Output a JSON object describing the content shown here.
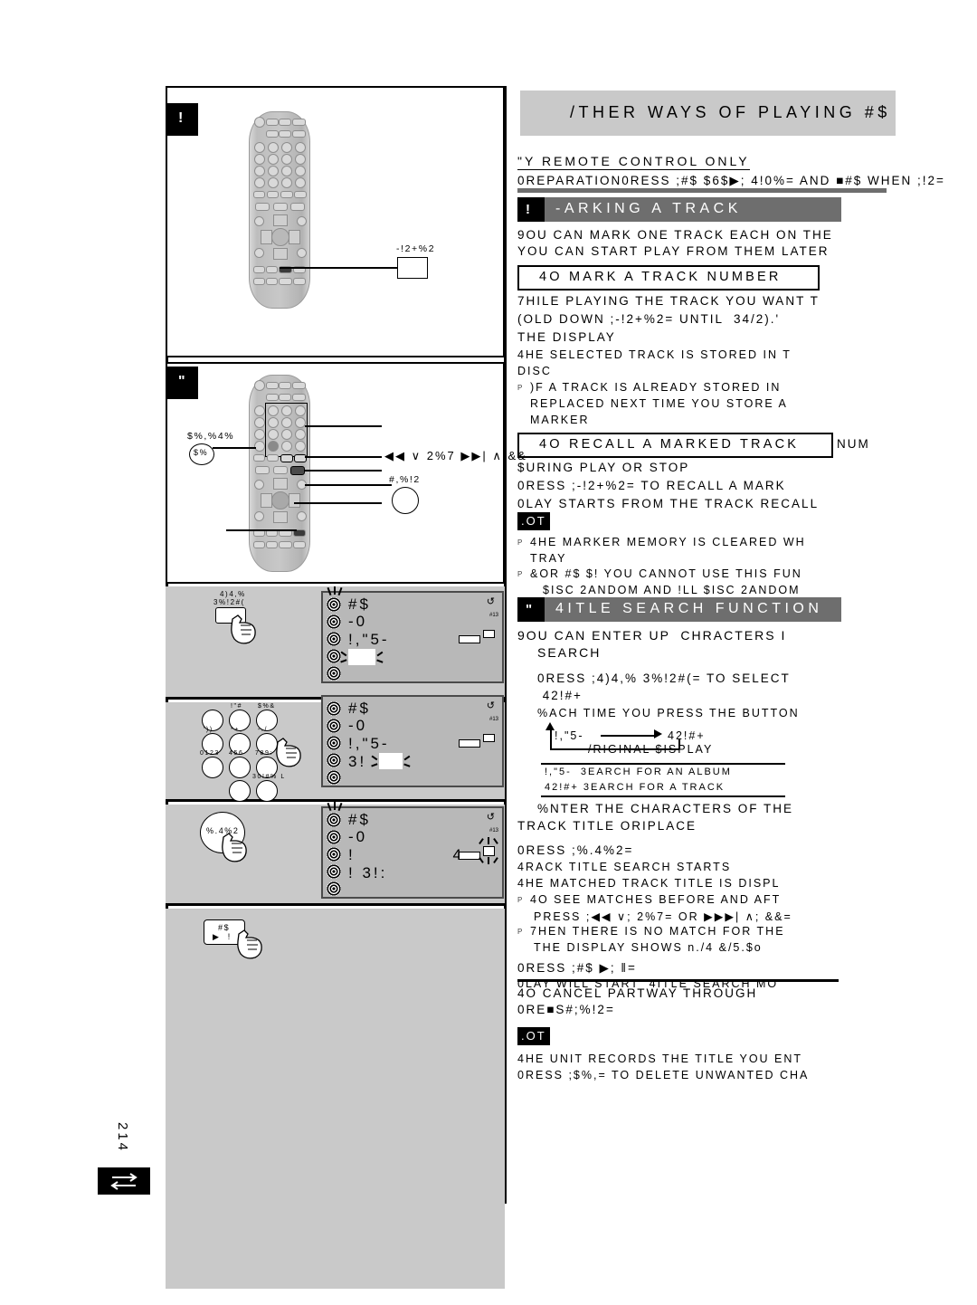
{
  "page": {
    "number": "214",
    "header_title": "/THER WAYS OF PLAYING #$",
    "subhead": "\"Y REMOTE CONTROL ONLY",
    "subline": "0REPARATION0RESS ;#$ $6$▶; 4!0%= AND  ■#$  WHEN ;!2=",
    "accent_gray": "#c9c9c9",
    "accent_darkgray": "#6e6e6e",
    "ink": "#000000"
  },
  "sections": [
    {
      "letter": "!",
      "title": "-ARKING A TRACK",
      "intro": [
        "9OU CAN MARK ONE TRACK EACH ON THE",
        "YOU CAN START PLAY FROM THEM LATER"
      ],
      "sub_boxes": [
        {
          "box_title": "4O MARK A TRACK NUMBER",
          "box_suffix": "",
          "lines": [
            "7HILE PLAYING THE TRACK YOU WANT T",
            "(OLD DOWN ;-!2+%2= UNTIL  34/2).'",
            "THE DISPLAY",
            "4HE SELECTED TRACK IS STORED IN T",
            "DISC"
          ],
          "bullets": [
            [
              ")F A TRACK IS ALREADY STORED IN",
              "REPLACED NEXT TIME YOU STORE A",
              "MARKER"
            ]
          ]
        },
        {
          "box_title": "4O RECALL A MARKED TRACK",
          "box_suffix": "NUM",
          "lines": [
            "$URING PLAY OR STOP",
            "0RESS ;-!2+%2= TO RECALL A MARK",
            "0LAY STARTS FROM THE TRACK RECALL"
          ],
          "bullets": []
        }
      ],
      "note": {
        "badge": ".OT",
        "bullets": [
          [
            "4HE MARKER MEMORY IS CLEARED WH",
            "TRAY"
          ],
          [
            "&OR #$ $! YOU CANNOT USE THIS FUN",
            "$ISC 2ANDOM AND !LL $ISC 2ANDOM"
          ]
        ]
      }
    },
    {
      "letter": "\"",
      "title": "4ITLE SEARCH FUNCTION",
      "intro": [
        "9OU CAN ENTER UP  CHRACTERS I",
        "SEARCH"
      ],
      "steps": [
        {
          "num": "",
          "lines": [
            "0RESS ;4)4,% 3%!2#(= TO SELECT",
            " 42!#+"
          ],
          "sub": [
            "%ACH TIME YOU PRESS THE BUTTON"
          ],
          "cycle": {
            "left": "!,\"5-",
            "right": "42!#+",
            "back": "/RIGINAL $ISPLAY"
          },
          "table": [
            "!,\"5-  3EARCH FOR AN ALBUM",
            "42!#+ 3EARCH FOR A TRACK"
          ]
        },
        {
          "num": "",
          "lines": [
            "%NTER THE CHARACTERS OF THE",
            "TRACK TITLE ORIPLACE"
          ],
          "sub": [],
          "cycle": null,
          "table": []
        },
        {
          "num": "",
          "lines": [
            "0RESS ;%.4%2="
          ],
          "sub": [
            "4RACK TITLE SEARCH STARTS",
            "4HE MATCHED TRACK TITLE IS DISPL"
          ],
          "bullets": [
            [
              "4O SEE MATCHES BEFORE AND AFT",
              "PRESS ;◀◀ ∨; 2%7= OR ▶▶▶| ∧; &&="
            ],
            [
              "7HEN THERE IS NO MATCH FOR THE",
              "THE DISPLAY SHOWS n./4 &/5.$o"
            ]
          ],
          "cycle": null,
          "table": []
        },
        {
          "num": "",
          "lines": [
            "0RESS ;#$ ▶; ‖="
          ],
          "sub": [
            "0LAY WILL START  4ITLE SEARCH MO"
          ],
          "cycle": null,
          "table": []
        }
      ],
      "cancel": {
        "title": "4O CANCEL PARTWAY THROUGH",
        "line": "0RE■S#;%!2="
      },
      "note": {
        "badge": ".OT",
        "lines": [
          "4HE UNIT RECORDS THE TITLE YOU ENT",
          "0RESS ;$%,= TO DELETE UNWANTED CHA"
        ]
      }
    }
  ],
  "illustrations": {
    "panel_a": {
      "tag": "!",
      "callout_label": "-!2+%2"
    },
    "panel_b": {
      "tag": "\"",
      "callouts": [
        {
          "label": "$%,%4%",
          "inner": "$%"
        },
        {
          "label": "◀◀ ∨ 2%7 ▶▶| ∧  &&"
        },
        {
          "label": "#,%!2"
        }
      ]
    },
    "step_panels": [
      {
        "button_label": "4)4,%\n3%!2#(",
        "button_type": "rect",
        "display": {
          "lines": [
            "#$",
            "-0",
            "!,\"5-",
            ""
          ],
          "flash_line_index": 3,
          "corner_glyph": "↺",
          "mini_label": "#13"
        }
      },
      {
        "button_label": "",
        "button_type": "keypad",
        "keypad_labels": [
          "",
          "!\"#",
          "$%&",
          "'))",
          "*+,",
          "-./",
          "0123",
          "456",
          "789:",
          "",
          "30!#% L"
        ],
        "display": {
          "lines": [
            "#$",
            "-0",
            "!,\"5-",
            "3!"
          ],
          "flash_line_index": 3,
          "corner_glyph": "↺",
          "mini_label": "#13"
        }
      },
      {
        "button_label": "%.4%2",
        "button_type": "circle",
        "display": {
          "lines": [
            "#$",
            "-0",
            "!",
            "! 3!:"
          ],
          "flash_line_index": -1,
          "corner_glyph": "↺",
          "mini_label": "#13",
          "right_glyph": "4"
        }
      },
      {
        "button_label": "#$\n▶  ‖",
        "button_type": "rect_play",
        "display": null
      }
    ]
  }
}
